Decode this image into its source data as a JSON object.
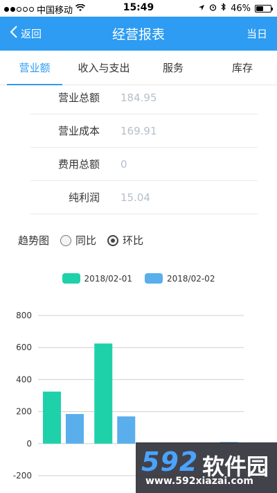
{
  "status_bar": {
    "carrier": "中国移动",
    "time": "15:49",
    "battery": "46%",
    "battery_level": 0.46
  },
  "nav": {
    "back_label": "返回",
    "title": "经营报表",
    "right_label": "当日"
  },
  "tabs": [
    {
      "label": "营业额",
      "active": true
    },
    {
      "label": "收入与支出",
      "active": false
    },
    {
      "label": "服务",
      "active": false
    },
    {
      "label": "库存",
      "active": false
    }
  ],
  "summary": [
    {
      "label": "营业总额",
      "value": "184.95"
    },
    {
      "label": "营业成本",
      "value": "169.91"
    },
    {
      "label": "费用总额",
      "value": "0"
    },
    {
      "label": "纯利润",
      "value": "15.04"
    }
  ],
  "trend": {
    "label": "趋势图",
    "options": [
      {
        "label": "同比",
        "checked": false
      },
      {
        "label": "环比",
        "checked": true
      }
    ]
  },
  "colors": {
    "accent": "#2d9cf2",
    "series_1": "#1fd1a9",
    "series_2": "#5aaeec"
  },
  "chart_data": {
    "type": "bar",
    "categories": [
      "",
      "",
      "",
      ""
    ],
    "series": [
      {
        "name": "2018/02-01",
        "values": [
          325,
          625,
          0,
          0
        ]
      },
      {
        "name": "2018/02-02",
        "values": [
          185,
          170,
          0,
          10
        ]
      }
    ],
    "yticks": [
      "800",
      "600",
      "400",
      "200",
      "0",
      "-200"
    ],
    "ylim": [
      -200,
      800
    ],
    "grid": true,
    "legend": "top-center"
  },
  "watermark": {
    "logo": "592",
    "name": "软件园",
    "url": "www.592xiazai.com"
  }
}
